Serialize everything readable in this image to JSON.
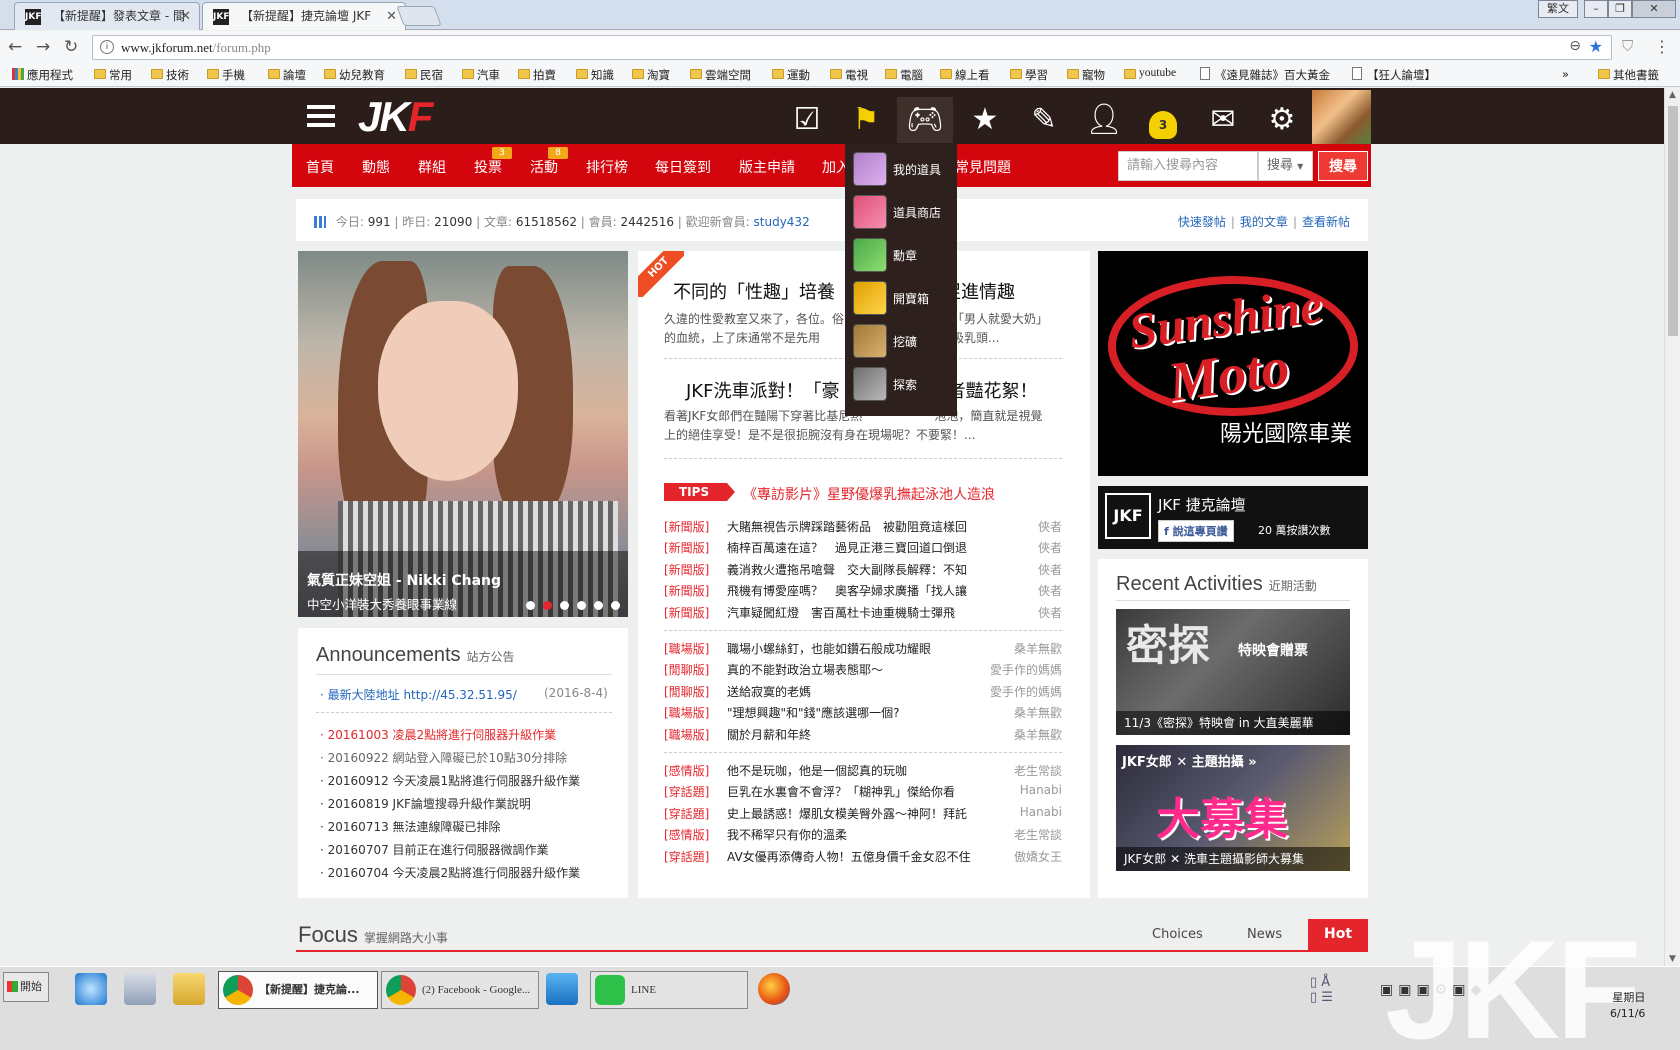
{
  "browser": {
    "tabs": [
      {
        "favicon": "JKF",
        "title": "【新提醒】發表文章 - 間"
      },
      {
        "favicon": "JKF",
        "title": "【新提醒】捷克論壇 JKF"
      }
    ],
    "ime": "繁文",
    "url_domain": "www.jkforum.net",
    "url_path": "/forum.php",
    "bookmarks": [
      "應用程式",
      "常用",
      "技術",
      "手機",
      "論壇",
      "幼兒教育",
      "民宿",
      "汽車",
      "拍賣",
      "知識",
      "淘寶",
      "雲端空間",
      "運動",
      "電視",
      "電腦",
      "線上看",
      "學習",
      "寵物",
      "youtube",
      "《遠見雜誌》百大黃金",
      "【狂人論壇】"
    ],
    "bookmarks_more": "»",
    "other_bookmarks": "其他書籤"
  },
  "header": {
    "logo_main": "JK",
    "logo_accent": "F",
    "bell_count": "3"
  },
  "nav": {
    "items": [
      "首頁",
      "動態",
      "群組",
      "投票",
      "活動",
      "排行榜",
      "每日簽到",
      "版主申請",
      "加入",
      "常見問題"
    ],
    "badges": {
      "vote": "3",
      "event": "8"
    },
    "search_placeholder": "請輸入搜尋內容",
    "search_select": "搜尋",
    "search_button": "搜尋"
  },
  "dropdown": [
    "我的道具",
    "道具商店",
    "勳章",
    "開寶箱",
    "挖礦",
    "探索"
  ],
  "stats": {
    "today_label": "今日:",
    "today": "991",
    "yesterday_label": "昨日:",
    "yesterday": "21090",
    "posts_label": "文章:",
    "posts": "61518562",
    "members_label": "會員:",
    "members": "2442516",
    "welcome_label": "歡迎新會員:",
    "newest": "study432",
    "links": [
      "快速發帖",
      "我的文章",
      "查看新帖"
    ]
  },
  "slider": {
    "title": "氣質正妹空姐 - Nikki Chang",
    "subtitle": "中空小洋裝大秀養眼事業線"
  },
  "announcements": {
    "title": "Announcements",
    "subtitle": "站方公告",
    "pinned": {
      "text": "最新大陸地址 http://45.32.51.95/",
      "date": "(2016-8-4)"
    },
    "items": [
      "20161003 凌晨2點將進行伺服器升級作業",
      "20160922 網站登入障礙已於10點30分排除",
      "20160912 今天凌晨1點將進行伺服器升級作業",
      "20160819 JKF論壇搜尋升級作業說明",
      "20160713 無法連線障礙已排除",
      "20160707 目前正在進行伺服器微調作業",
      "20160704 今天凌晨2點將進行伺服器升級作業"
    ]
  },
  "hot": {
    "badge": "HOT",
    "stories": [
      {
        "title": "不同的「性趣」培養　　　　　樣促進情趣",
        "excerpt": "久違的性愛教室又來了，各位。俗　　　　　　　就了「男人就愛大奶」的血統，上了床通常不是先用　　　　　　　下頭拚命吸乳頭..."
      },
      {
        "title": "JKF洗車派對！「豪　　　　　　者豔花絮！",
        "excerpt": "看著JKF女郎們在豔陽下穿著比基尼熱　　　　　　泡泡，簡直就是視覺上的絕佳享受！是不是很扼腕沒有身在現場呢？不要緊！..."
      }
    ]
  },
  "tips": {
    "badge": "TIPS",
    "headline": "《專訪影片》星野優爆乳撫起泳池人造浪"
  },
  "news_groups": [
    [
      {
        "cat": "[新聞版]",
        "title": "大賭無視告示牌踩踏藝術品　被勸阻竟這樣回",
        "author": "俠者"
      },
      {
        "cat": "[新聞版]",
        "title": "楠梓百萬遠在這？　過見正港三寶回道口倒退",
        "author": "俠者"
      },
      {
        "cat": "[新聞版]",
        "title": "義消救火遭拖吊嗆聲　交大副隊長解釋：不知",
        "author": "俠者"
      },
      {
        "cat": "[新聞版]",
        "title": "飛機有博愛座嗎？　奧客孕婦求廣播「找人讓",
        "author": "俠者"
      },
      {
        "cat": "[新聞版]",
        "title": "汽車疑闖紅燈　害百萬杜卡迪重機騎士彈飛",
        "author": "俠者"
      }
    ],
    [
      {
        "cat": "[職場版]",
        "title": "職場小螺絲釘，也能如鑽石般成功耀眼",
        "author": "桑羊無歡"
      },
      {
        "cat": "[閒聊版]",
        "title": "真的不能對政治立場表態耶～",
        "author": "愛手作的媽媽"
      },
      {
        "cat": "[閒聊版]",
        "title": "送給寂寞的老媽",
        "author": "愛手作的媽媽"
      },
      {
        "cat": "[職場版]",
        "title": "\"理想興趣\"和\"錢\"應該選哪一個?",
        "author": "桑羊無歡"
      },
      {
        "cat": "[職場版]",
        "title": "關於月薪和年終",
        "author": "桑羊無歡"
      }
    ],
    [
      {
        "cat": "[感情版]",
        "title": "他不是玩咖，他是一個認真的玩咖",
        "author": "老生常談"
      },
      {
        "cat": "[穿話題]",
        "title": "巨乳在水裏會不會浮？「糊神乳」傑給你看",
        "author": "Hanabi"
      },
      {
        "cat": "[穿話題]",
        "title": "史上最誘惑！爆肌女模美臀外露～神阿！拜託",
        "author": "Hanabi"
      },
      {
        "cat": "[感情版]",
        "title": "我不稀罕只有你的溫柔",
        "author": "老生常談"
      },
      {
        "cat": "[穿話題]",
        "title": "AV女優再添傳奇人物！五億身價千金女忍不住",
        "author": "傲嬌女王"
      }
    ]
  ],
  "ad": {
    "brand_line1": "Sunshine",
    "brand_line2": "Moto",
    "brand_cn": "陽光國際車業"
  },
  "fb_widget": {
    "logo": "JKF",
    "name": "JKF 捷克論壇",
    "like_button": "說這專頁讚",
    "count": "20 萬按讚次數"
  },
  "recent": {
    "title": "Recent Activities",
    "subtitle": "近期活動",
    "cards": [
      {
        "big": "密探",
        "sub": "特映會贈票",
        "caption": "11/3《密探》特映會 in 大直美麗華"
      },
      {
        "tag": "JKF女郎 ✕ 主題拍攝 »",
        "big": "大募集",
        "caption": "JKF女郎 ✕ 洗車主題攝影師大募集"
      }
    ]
  },
  "focus": {
    "title": "Focus",
    "subtitle": "掌握網路大小事",
    "tabs": [
      "Choices",
      "News",
      "Hot"
    ]
  },
  "taskbar": {
    "start": "開始",
    "tasks": [
      {
        "label": "【新提醒】捷克論...",
        "active": true
      },
      {
        "label": "(2) Facebook - Google...",
        "active": false
      },
      {
        "label": "LINE",
        "active": false
      }
    ],
    "clock_day": "星期日",
    "clock_date": "6/11/6"
  },
  "watermark": "JKF",
  "colors": {
    "jkf_red": "#d3060d",
    "header_bg": "#2b1d19",
    "hot_orange": "#ef4d24"
  }
}
